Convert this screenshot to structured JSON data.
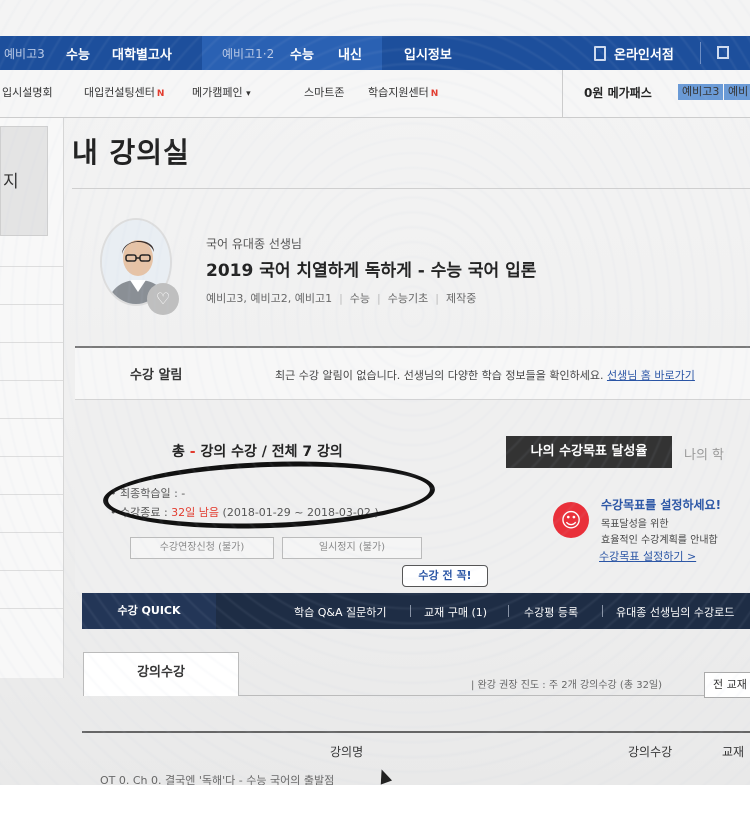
{
  "topnav": {
    "item1": "예비고3",
    "item2": "수능",
    "item3": "대학별고사",
    "item4": "예비고1·2",
    "item5": "수능",
    "item6": "내신",
    "item7": "입시정보",
    "item8": "온라인서점"
  },
  "subnav": {
    "item1": "입시설명회",
    "item2": "대입컨설팅센터",
    "item3": "메가캠페인",
    "item4": "스마트존",
    "item5": "학습지원센터",
    "new_badge": "N",
    "pass_label": "0원 메가패스",
    "pass_tag1": "예비고3",
    "pass_tag2": "예비"
  },
  "left": {
    "tab_label": "지"
  },
  "page": {
    "title": "내 강의실"
  },
  "course": {
    "teacher": "국어 유대종 선생님",
    "title": "2019 국어 치열하게 독하게 - 수능 국어 입론",
    "meta1": "예비고3, 예비고2, 예비고1",
    "meta2": "수능",
    "meta3": "수능기초",
    "meta4": "제작중"
  },
  "notice": {
    "label": "수강 알림",
    "text": "최근 수강 알림이 없습니다. 선생님의 다양한 학습 정보들을 확인하세요.",
    "link": "선생님 홈 바로가기"
  },
  "summary": {
    "total_prefix": "총",
    "dash": "-",
    "total_text": "강의 수강 / 전체 7 강의",
    "last_study_label": "• 최종학습일 : -",
    "end_label": "• 수강종료 :",
    "end_days": "32일 남음",
    "end_period": "(2018-01-29 ~ 2018-03-02 )",
    "extend_btn": "수강연장신청 (불가)",
    "pause_btn": "일시정지 (불가)"
  },
  "goal": {
    "tab_active": "나의 수강목표 달성율",
    "tab_inactive": "나의 학",
    "heading": "수강목표를 설정하세요!",
    "line1": "목표달성을 위한",
    "line2": "효율적인 수강계획를 안내합",
    "link": "수강목표 설정하기 >"
  },
  "tooltip": "수강 전 꼭!",
  "quick": {
    "label": "수강 QUICK",
    "item1": "학습 Q&A 질문하기",
    "item2": "교재 구매 (1)",
    "item3": "수강평 등록",
    "item4": "유대종 선생님의 수강로드"
  },
  "lecture": {
    "tab": "강의수강",
    "progress": "| 완강 권장 진도 : 주 2개 강의수강 (총 32일)",
    "all_btn": "전 교재"
  },
  "table": {
    "col1": "강의명",
    "col2": "강의수강",
    "col3": "교재",
    "ghost_row": "OT 0. Ch 0. 결국엔 '독해'다 - 수능 국어의 출발점"
  }
}
